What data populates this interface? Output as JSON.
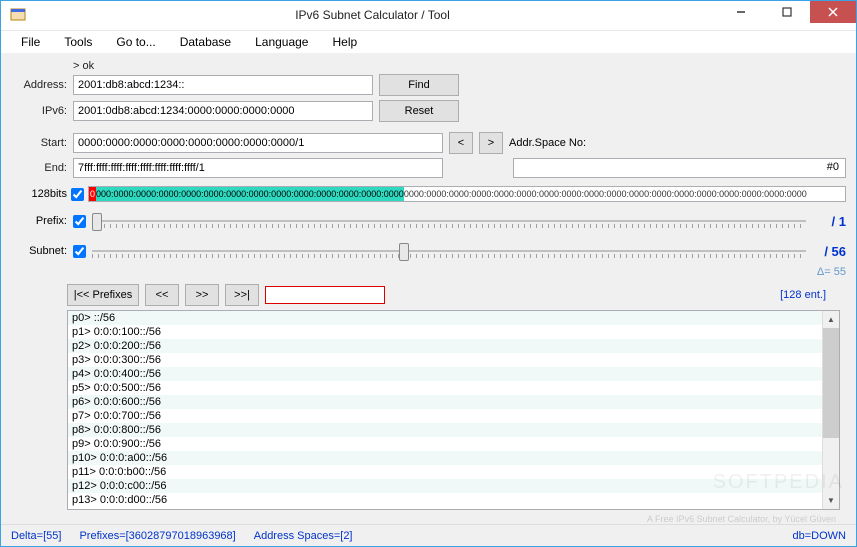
{
  "window": {
    "title": "IPv6 Subnet Calculator / Tool"
  },
  "menu": {
    "file": "File",
    "tools": "Tools",
    "goto": "Go to...",
    "database": "Database",
    "language": "Language",
    "help": "Help"
  },
  "okline": "> ok",
  "labels": {
    "address": "Address:",
    "ipv6": "IPv6:",
    "start": "Start:",
    "end": "End:",
    "bits": "128bits",
    "prefix": "Prefix:",
    "subnet": "Subnet:",
    "addrspace": "Addr.Space No:"
  },
  "fields": {
    "address": "2001:db8:abcd:1234::",
    "ipv6": "2001:0db8:abcd:1234:0000:0000:0000:0000",
    "start": "0000:0000:0000:0000:0000:0000:0000:0000/1",
    "end": "7fff:ffff:ffff:ffff:ffff:ffff:ffff:ffff/1",
    "addrspace_value": "#0"
  },
  "buttons": {
    "find": "Find",
    "reset": "Reset",
    "prev": "<",
    "next": ">",
    "prefixes": "|<< Prefixes",
    "back": "<<",
    "fwd": ">>",
    "last": ">>|"
  },
  "bits": {
    "red": "0",
    "teal": "000:0000:0000:0000:0000:0000:0000:0000:0000:0000:0000:0000:0000:0000",
    "rest": "0000:0000:0000:0000:0000:0000:0000:0000:0000:0000:0000:0000:0000:0000:0000:0000:0000:0000"
  },
  "sliders": {
    "prefix_val": "/ 1",
    "subnet_val": "/ 56",
    "delta": "Δ= 55"
  },
  "list": {
    "count": "[128 ent.]",
    "items": [
      "p0> ::/56",
      "p1> 0:0:0:100::/56",
      "p2> 0:0:0:200::/56",
      "p3> 0:0:0:300::/56",
      "p4> 0:0:0:400::/56",
      "p5> 0:0:0:500::/56",
      "p6> 0:0:0:600::/56",
      "p7> 0:0:0:700::/56",
      "p8> 0:0:0:800::/56",
      "p9> 0:0:0:900::/56",
      "p10> 0:0:0:a00::/56",
      "p11> 0:0:0:b00::/56",
      "p12> 0:0:0:c00::/56",
      "p13> 0:0:0:d00::/56"
    ]
  },
  "footer_note": "A Free IPv6 Subnet Calculator, by Yücel Güven",
  "status": {
    "delta": "Delta=[55]",
    "prefixes": "Prefixes=[36028797018963968]",
    "addrspaces": "Address Spaces=[2]",
    "db": "db=DOWN"
  },
  "watermark": "SOFTPEDIA"
}
